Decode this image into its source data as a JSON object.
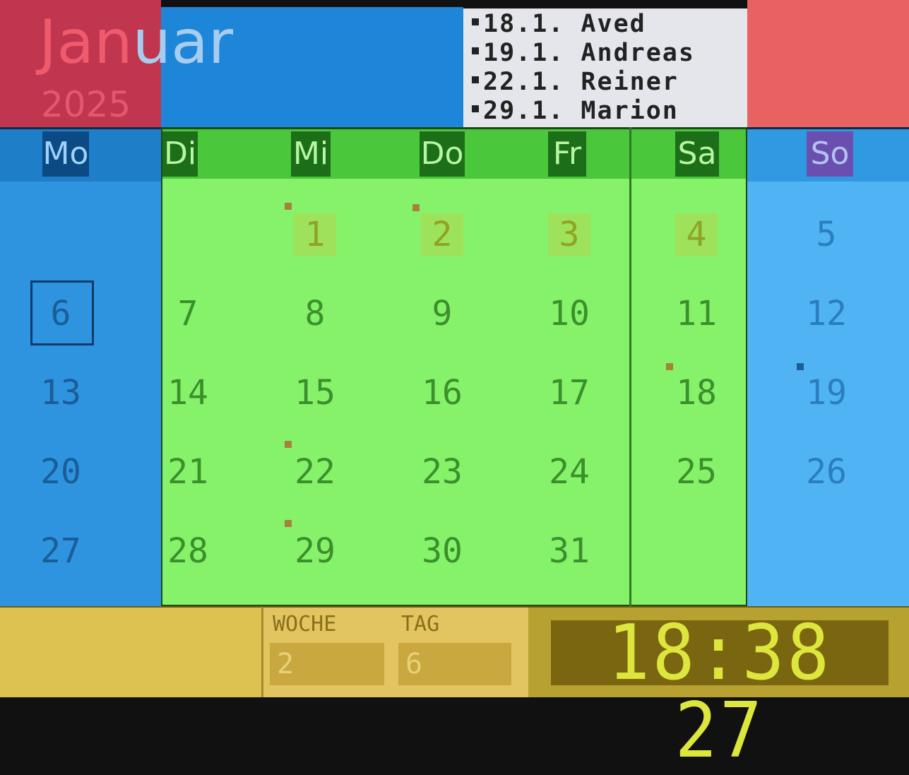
{
  "header": {
    "month_part_a": "Jan",
    "month_part_b": "uar",
    "year": "2025"
  },
  "events": [
    {
      "text": "18.1. Aved"
    },
    {
      "text": "19.1. Andreas"
    },
    {
      "text": "22.1. Reiner"
    },
    {
      "text": "29.1. Marion"
    }
  ],
  "weekdays": {
    "mo": "Mo",
    "di": "Di",
    "mi": "Mi",
    "do": "Do",
    "fr": "Fr",
    "sa": "Sa",
    "so": "So"
  },
  "days": {
    "d1": "1",
    "d2": "2",
    "d3": "3",
    "d4": "4",
    "d5": "5",
    "d6": "6",
    "d7": "7",
    "d8": "8",
    "d9": "9",
    "d10": "10",
    "d11": "11",
    "d12": "12",
    "d13": "13",
    "d14": "14",
    "d15": "15",
    "d16": "16",
    "d17": "17",
    "d18": "18",
    "d19": "19",
    "d20": "20",
    "d21": "21",
    "d22": "22",
    "d23": "23",
    "d24": "24",
    "d25": "25",
    "d26": "26",
    "d27": "27",
    "d28": "28",
    "d29": "29",
    "d30": "30",
    "d31": "31"
  },
  "footer": {
    "woche_label": "WOCHE",
    "woche_value": "2",
    "tag_label": "TAG",
    "tag_value": "6",
    "clock": "18:38 27"
  },
  "colors": {
    "month_block": "#c0364f",
    "header_blue": "#1e86d9",
    "header_red": "#e96262",
    "weekday_green": "#86f26a",
    "weekend_blue": "#50b3f3",
    "footer_yellow": "#ddc151",
    "clock_digits": "#dde63c"
  }
}
